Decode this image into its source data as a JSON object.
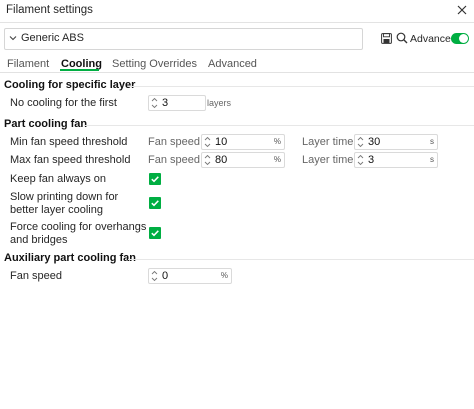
{
  "window": {
    "title": "Filament settings"
  },
  "preset": {
    "selected": "Generic ABS"
  },
  "toolbar": {
    "advanced_label": "Advanced",
    "advanced_on": true
  },
  "tabs": [
    {
      "label": "Filament",
      "active": false
    },
    {
      "label": "Cooling",
      "active": true
    },
    {
      "label": "Setting Overrides",
      "active": false
    },
    {
      "label": "Advanced",
      "active": false
    }
  ],
  "sections": {
    "cooling_specific": {
      "title": "Cooling for specific layer",
      "no_cooling": {
        "label": "No cooling for the first",
        "value": "3",
        "unit": "layers"
      }
    },
    "part_fan": {
      "title": "Part cooling fan",
      "min_fan": {
        "label": "Min fan speed threshold",
        "fan_label": "Fan speed",
        "fan_value": "10",
        "fan_unit": "%",
        "layer_label": "Layer time",
        "layer_value": "30",
        "layer_unit": "s"
      },
      "max_fan": {
        "label": "Max fan speed threshold",
        "fan_label": "Fan speed",
        "fan_value": "80",
        "fan_unit": "%",
        "layer_label": "Layer time",
        "layer_value": "3",
        "layer_unit": "s"
      },
      "keep_fan": {
        "label": "Keep fan always on",
        "checked": true
      },
      "slow_down": {
        "label_line1": "Slow printing down for",
        "label_line2": "better layer cooling",
        "checked": true
      },
      "force_cooling": {
        "label_line1": "Force cooling for overhangs",
        "label_line2": "and bridges",
        "checked": true
      }
    },
    "aux_fan": {
      "title": "Auxiliary part cooling fan",
      "fan_speed": {
        "label": "Fan speed",
        "value": "0",
        "unit": "%"
      }
    }
  },
  "colors": {
    "accent": "#00ae42",
    "text": "#262626",
    "border": "#dadada"
  }
}
